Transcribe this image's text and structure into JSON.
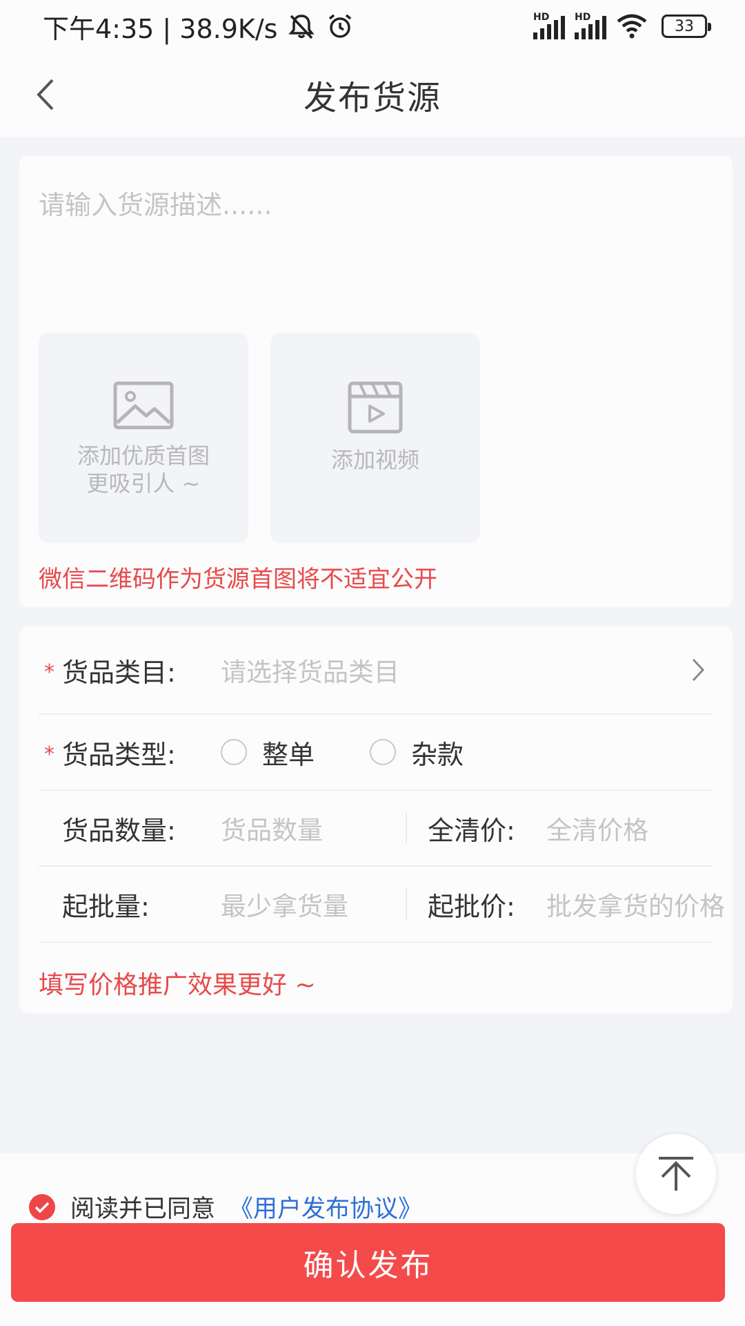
{
  "status_bar": {
    "time_and_speed": "下午4:35 | 38.9K/s",
    "signal_1_label": "HD",
    "signal_2_label": "HD",
    "battery_level": "33",
    "icons": [
      "mute-icon",
      "alarm-icon",
      "signal-icon",
      "signal-icon",
      "wifi-icon",
      "battery-icon"
    ]
  },
  "nav": {
    "title": "发布货源",
    "back_icon": "chevron-left-icon"
  },
  "description": {
    "placeholder": "请输入货源描述......",
    "value": ""
  },
  "uploads": {
    "image_tile_line1": "添加优质首图",
    "image_tile_line2": "更吸引人 ~",
    "image_icon": "image-icon",
    "video_tile_label": "添加视频",
    "video_icon": "video-icon"
  },
  "qr_warning": "微信二维码作为货源首图将不适宜公开",
  "form": {
    "required_mark": "*",
    "category": {
      "label": "货品类目:",
      "placeholder": "请选择货品类目"
    },
    "type": {
      "label": "货品类型:",
      "options": [
        "整单",
        "杂款"
      ],
      "selected": ""
    },
    "quantity": {
      "label": "货品数量:",
      "placeholder": "货品数量"
    },
    "clearance_price": {
      "label": "全清价:",
      "placeholder": "全清价格"
    },
    "min_batch": {
      "label": "起批量:",
      "placeholder": "最少拿货量"
    },
    "batch_price": {
      "label": "起批价:",
      "placeholder": "批发拿货的价格"
    },
    "price_tip": "填写价格推广效果更好 ~"
  },
  "agreement": {
    "checked": true,
    "text": "阅读并已同意",
    "link": "《用户发布协议》"
  },
  "confirm_button": "确认发布",
  "colors": {
    "accent_red": "#f44a4a",
    "warning_red": "#e8494a",
    "link_blue": "#2e6fd6",
    "page_bg": "#f2f4f8",
    "placeholder_gray": "#c4c4c4"
  }
}
